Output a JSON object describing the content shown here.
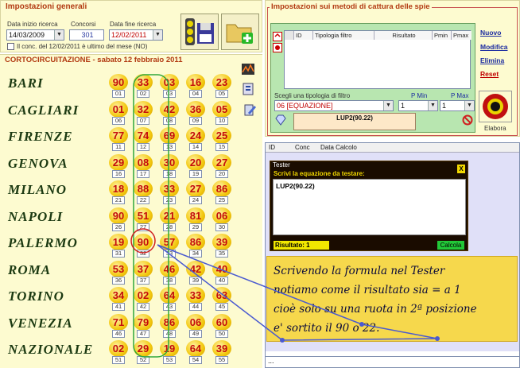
{
  "general": {
    "title": "Impostazioni generali",
    "start_label": "Data inizio ricerca",
    "start_value": "14/03/2009",
    "concorsi_label": "Concorsi",
    "concorsi_value": "301",
    "end_label": "Data fine ricerca",
    "end_value": "12/02/2011",
    "check_label": "Il conc. del 12/02/2011 è ultimo del mese (NO)"
  },
  "corto": {
    "title": "CORTOCIRCUITAZIONE - sabato 12 febbraio 2011",
    "rows": [
      {
        "city": "BARI",
        "nums": [
          "90",
          "33",
          "03",
          "16",
          "23"
        ],
        "subs": [
          "01",
          "02",
          "03",
          "04",
          "05"
        ]
      },
      {
        "city": "CAGLIARI",
        "nums": [
          "01",
          "32",
          "42",
          "36",
          "05"
        ],
        "subs": [
          "06",
          "07",
          "08",
          "09",
          "10"
        ]
      },
      {
        "city": "FIRENZE",
        "nums": [
          "77",
          "74",
          "69",
          "24",
          "25"
        ],
        "subs": [
          "11",
          "12",
          "13",
          "14",
          "15"
        ]
      },
      {
        "city": "GENOVA",
        "nums": [
          "29",
          "08",
          "30",
          "20",
          "27"
        ],
        "subs": [
          "16",
          "17",
          "18",
          "19",
          "20"
        ]
      },
      {
        "city": "MILANO",
        "nums": [
          "18",
          "88",
          "33",
          "27",
          "86"
        ],
        "subs": [
          "21",
          "22",
          "23",
          "24",
          "25"
        ]
      },
      {
        "city": "NAPOLI",
        "nums": [
          "90",
          "51",
          "21",
          "81",
          "06"
        ],
        "subs": [
          "26",
          "27",
          "28",
          "29",
          "30"
        ]
      },
      {
        "city": "PALERMO",
        "nums": [
          "19",
          "90",
          "57",
          "86",
          "39"
        ],
        "subs": [
          "31",
          "32",
          "33",
          "34",
          "35"
        ]
      },
      {
        "city": "ROMA",
        "nums": [
          "53",
          "37",
          "46",
          "42",
          "40"
        ],
        "subs": [
          "36",
          "37",
          "38",
          "39",
          "40"
        ]
      },
      {
        "city": "TORINO",
        "nums": [
          "34",
          "02",
          "64",
          "33",
          "63"
        ],
        "subs": [
          "41",
          "42",
          "43",
          "44",
          "45"
        ]
      },
      {
        "city": "VENEZIA",
        "nums": [
          "71",
          "79",
          "86",
          "06",
          "60"
        ],
        "subs": [
          "46",
          "47",
          "48",
          "49",
          "50"
        ]
      },
      {
        "city": "NAZIONALE",
        "nums": [
          "02",
          "29",
          "19",
          "64",
          "39"
        ],
        "subs": [
          "51",
          "52",
          "53",
          "54",
          "55"
        ]
      }
    ]
  },
  "methods": {
    "title": "Impostazioni sui metodi di cattura delle spie",
    "columns": [
      "ID",
      "Tipologia filtro",
      "Risultato",
      "Pmin",
      "Pmax"
    ],
    "links": {
      "nuovo": "Nuovo",
      "modifica": "Modifica",
      "elimina": "Elimina",
      "reset": "Reset"
    },
    "filter_label": "Scegli una tipologia di filtro",
    "filter_value": "06 [EQUAZIONE]",
    "pmin_label": "P Min",
    "pmin_value": "1",
    "pmax_label": "P Max",
    "pmax_value": "1",
    "equation": "LUP2(90.22)",
    "elabora": "Elabora"
  },
  "conc_table": {
    "columns": [
      "ID",
      "Conc",
      "Data Calcolo"
    ]
  },
  "tester": {
    "title": "Tester",
    "close": "X",
    "prompt": "Scrivi la equazione da testare:",
    "formula": "LUP2(90.22)",
    "result": "Risultato: 1",
    "button": "Calcola"
  },
  "note": {
    "line1": "Scrivendo la formula nel Tester",
    "line2": "notiamo come il risultato sia = a 1",
    "line3": "cioè solo su una ruota in 2ª posizione",
    "line4": "e' sortito il 90 o 22."
  },
  "bottom": {
    "text": "..."
  }
}
